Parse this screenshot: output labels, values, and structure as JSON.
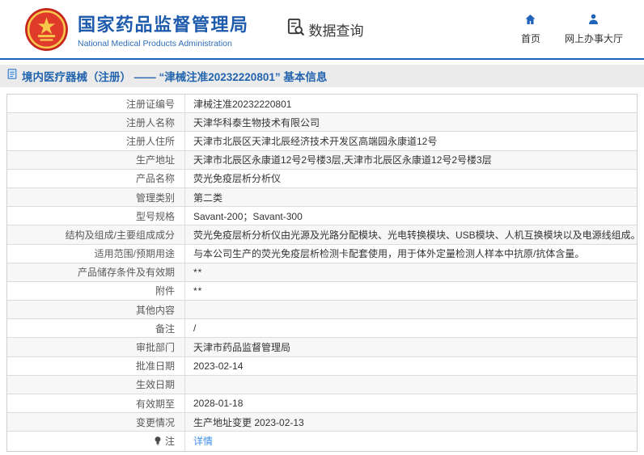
{
  "header": {
    "org_name_cn": "国家药品监督管理局",
    "org_name_en": "National Medical Products Administration",
    "section_label": "数据查询",
    "nav_home": "首页",
    "nav_hall": "网上办事大厅"
  },
  "breadcrumb": {
    "title": "境内医疗器械（注册） —— “津械注准20232220801” 基本信息"
  },
  "table": {
    "rows": [
      {
        "label": "注册证编号",
        "value": "津械注准20232220801"
      },
      {
        "label": "注册人名称",
        "value": "天津华科泰生物技术有限公司"
      },
      {
        "label": "注册人住所",
        "value": "天津市北辰区天津北辰经济技术开发区高端园永康道12号"
      },
      {
        "label": "生产地址",
        "value": "天津市北辰区永康道12号2号楼3层,天津市北辰区永康道12号2号楼3层"
      },
      {
        "label": "产品名称",
        "value": "荧光免疫层析分析仪"
      },
      {
        "label": "管理类别",
        "value": "第二类"
      },
      {
        "label": "型号规格",
        "value": "Savant-200；Savant-300"
      },
      {
        "label": "结构及组成/主要组成成分",
        "value": "荧光免疫层析分析仪由光源及光路分配模块、光电转换模块、USB模块、人机互换模块以及电源线组成。"
      },
      {
        "label": "适用范围/预期用途",
        "value": "与本公司生产的荧光免疫层析检测卡配套使用，用于体外定量检测人样本中抗原/抗体含量。"
      },
      {
        "label": "产品储存条件及有效期",
        "value": "**"
      },
      {
        "label": "附件",
        "value": "**"
      },
      {
        "label": "其他内容",
        "value": ""
      },
      {
        "label": "备注",
        "value": "/"
      },
      {
        "label": "审批部门",
        "value": "天津市药品监督管理局"
      },
      {
        "label": "批准日期",
        "value": "2023-02-14"
      },
      {
        "label": "生效日期",
        "value": ""
      },
      {
        "label": "有效期至",
        "value": "2028-01-18"
      },
      {
        "label": "变更情况",
        "value": "生产地址变更 2023-02-13"
      },
      {
        "label": "注",
        "value": "详情",
        "link": true,
        "label_icon": "bulb-icon"
      }
    ]
  },
  "colors": {
    "brand_blue": "#1e5bac",
    "divider_blue": "#1766bb",
    "breadcrumb_bg": "#ebebeb",
    "link_blue": "#3f8fe8",
    "alt_row_bg": "#f7f7f7",
    "emblem_red": "#d5281e",
    "emblem_gold": "#f7c84b"
  }
}
